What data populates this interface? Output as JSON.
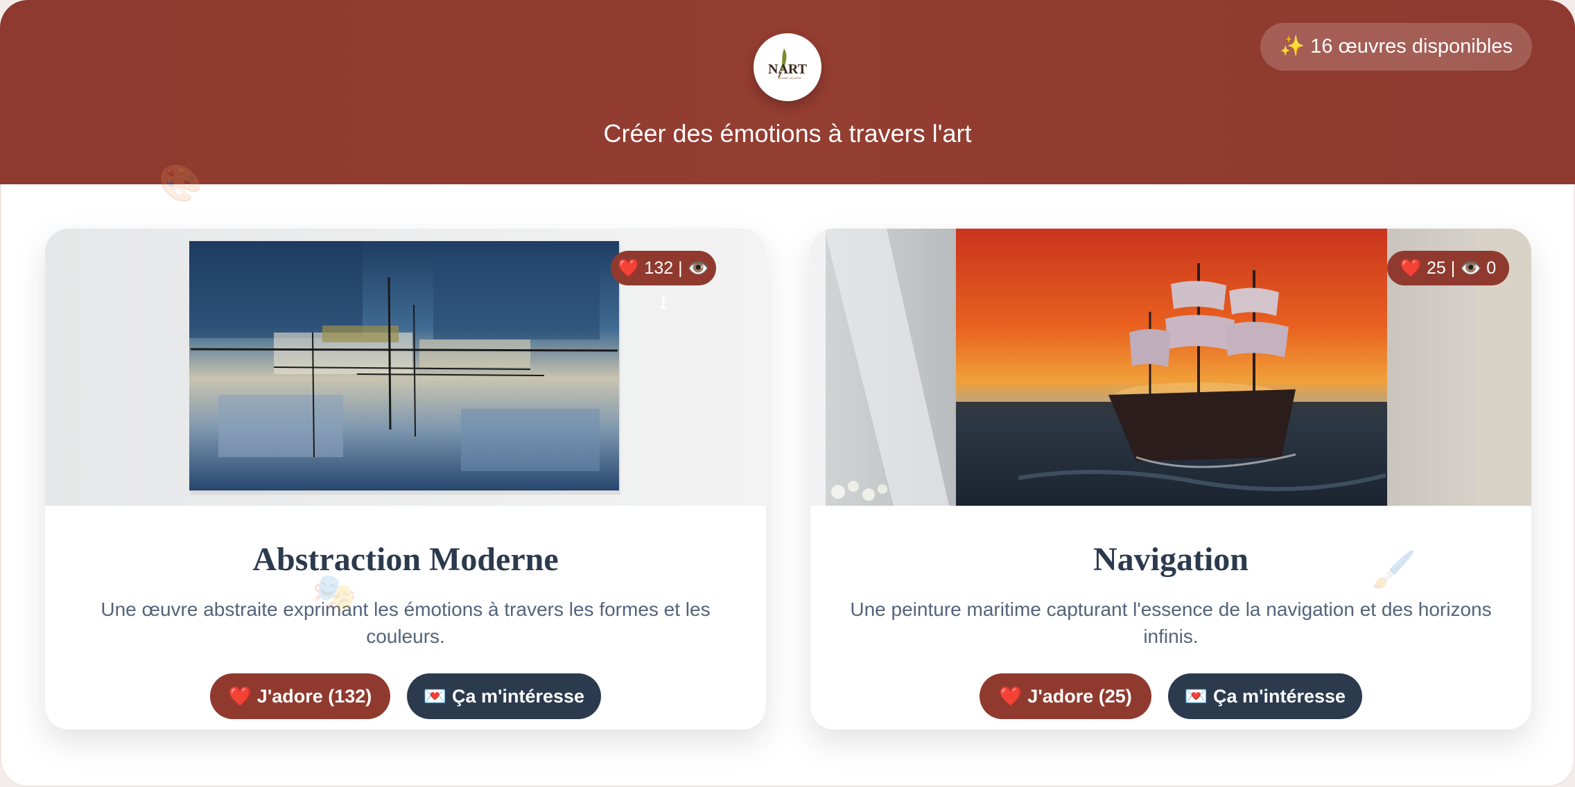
{
  "header": {
    "logo_text": "NART",
    "logo_subtext": "ONLINE GALLERY",
    "tagline": "Créer des émotions à travers l'art",
    "count_badge": "✨ 16 œuvres disponibles"
  },
  "decorations": [
    "🎨",
    "🎭",
    "🖌️"
  ],
  "artworks": [
    {
      "title": "Abstraction Moderne",
      "description": "Une œuvre abstraite exprimant les émotions à travers les formes et les couleurs.",
      "stats": "❤️ 132 | 👁️ 1",
      "love_label": "❤️ J'adore (132)",
      "interest_label": "💌 Ça m'intéresse",
      "likes": 132,
      "views": 1
    },
    {
      "title": "Navigation",
      "description": "Une peinture maritime capturant l'essence de la navigation et des horizons infinis.",
      "stats": "❤️ 25 | 👁️ 0",
      "love_label": "❤️ J'adore (25)",
      "interest_label": "💌 Ça m'intéresse",
      "likes": 25,
      "views": 0
    }
  ],
  "colors": {
    "brand": "#903a2f",
    "dark": "#2c3a4e",
    "text_muted": "#54637a"
  }
}
